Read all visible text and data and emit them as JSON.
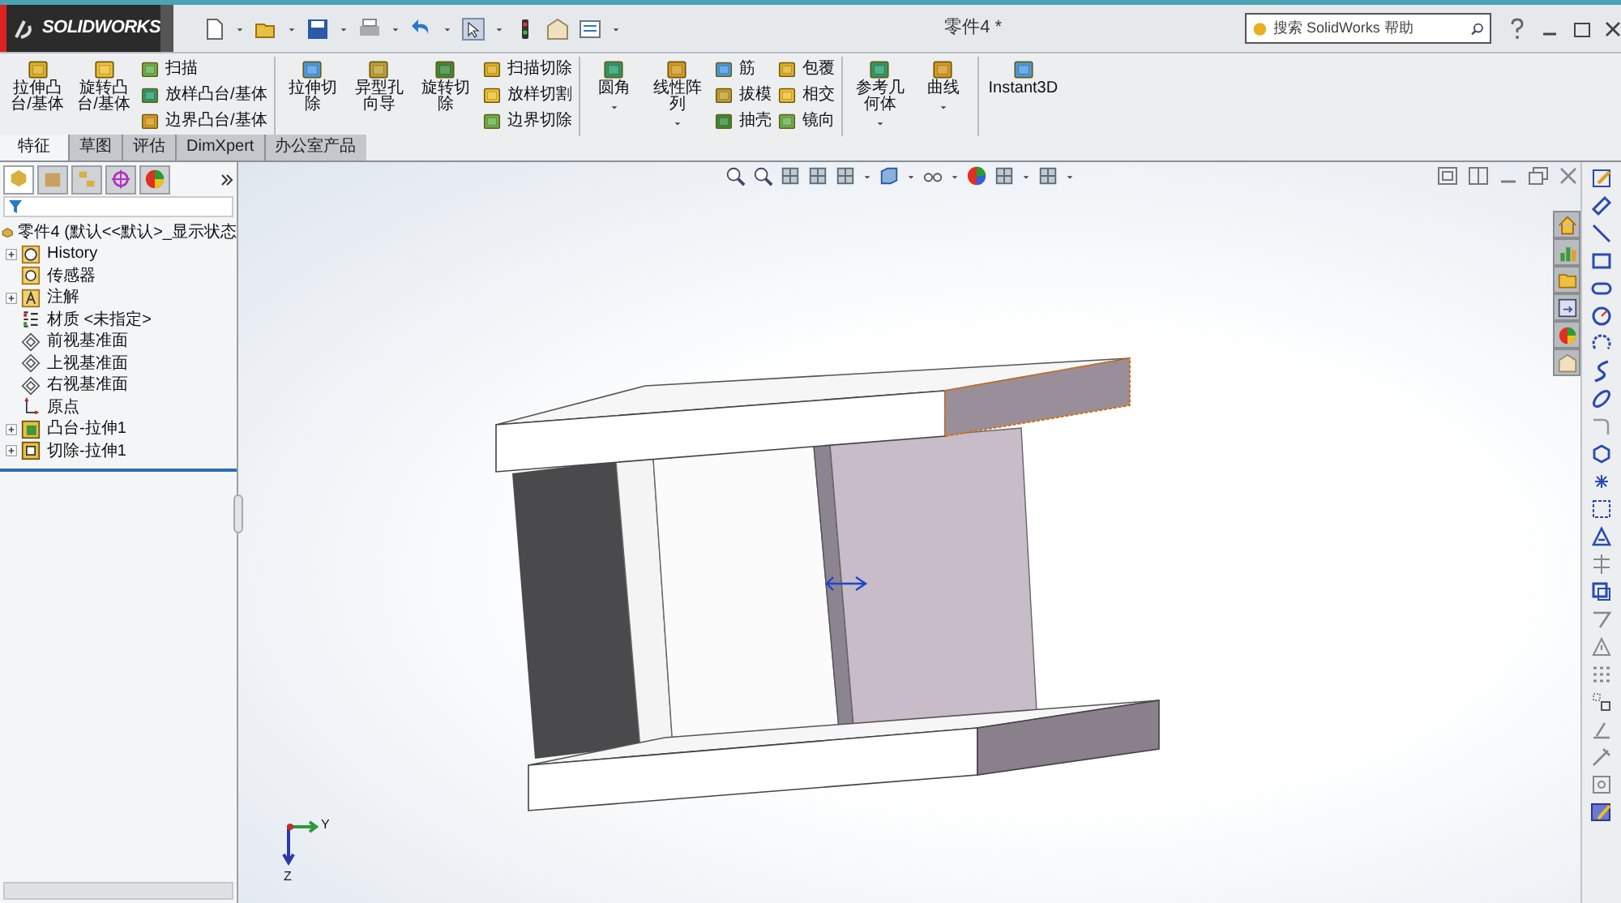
{
  "title_bar": {
    "logo": "SOLIDWORKS",
    "document_title": "零件4 *",
    "search": {
      "placeholder": "搜索 SolidWorks 帮助"
    }
  },
  "ribbon": {
    "groups": [
      {
        "columns": [
          {
            "kind": "large",
            "label": "拉伸凸台/基体",
            "dropdown": false
          },
          {
            "kind": "large",
            "label": "旋转凸台/基体",
            "dropdown": false
          },
          {
            "kind": "stack",
            "items": [
              "扫描",
              "放样凸台/基体",
              "边界凸台/基体"
            ]
          }
        ]
      },
      {
        "columns": [
          {
            "kind": "large",
            "label": "拉伸切除",
            "dropdown": false
          },
          {
            "kind": "large",
            "label": "异型孔向导",
            "dropdown": false
          },
          {
            "kind": "large",
            "label": "旋转切除",
            "dropdown": false
          },
          {
            "kind": "stack",
            "items": [
              "扫描切除",
              "放样切割",
              "边界切除"
            ]
          }
        ]
      },
      {
        "columns": [
          {
            "kind": "large",
            "label": "圆角",
            "dropdown": true
          },
          {
            "kind": "large",
            "label": "线性阵列",
            "dropdown": true
          },
          {
            "kind": "stack",
            "items": [
              "筋",
              "拔模",
              "抽壳"
            ]
          },
          {
            "kind": "stack",
            "items": [
              "包覆",
              "相交",
              "镜向"
            ]
          }
        ]
      },
      {
        "columns": [
          {
            "kind": "large",
            "label": "参考几何体",
            "dropdown": true
          },
          {
            "kind": "large",
            "label": "曲线",
            "dropdown": true
          }
        ]
      },
      {
        "columns": [
          {
            "kind": "large",
            "label": "Instant3D",
            "dropdown": false
          }
        ]
      }
    ]
  },
  "tabs": [
    {
      "label": "特征",
      "selected": true
    },
    {
      "label": "草图",
      "selected": false
    },
    {
      "label": "评估",
      "selected": false
    },
    {
      "label": "DimXpert",
      "selected": false
    },
    {
      "label": "办公室产品",
      "selected": false
    }
  ],
  "feature_tree": {
    "root": "零件4 (默认<<默认>_显示状态",
    "items": [
      {
        "label": "History",
        "expandable": true
      },
      {
        "label": "传感器",
        "expandable": false
      },
      {
        "label": "注解",
        "expandable": true
      },
      {
        "label": "材质 <未指定>",
        "expandable": false
      },
      {
        "label": "前视基准面",
        "expandable": false
      },
      {
        "label": "上视基准面",
        "expandable": false
      },
      {
        "label": "右视基准面",
        "expandable": false
      },
      {
        "label": "原点",
        "expandable": false
      },
      {
        "label": "凸台-拉伸1",
        "expandable": true
      },
      {
        "label": "切除-拉伸1",
        "expandable": true
      }
    ]
  },
  "triad": {
    "y_label": "Y",
    "z_label": "Z"
  }
}
